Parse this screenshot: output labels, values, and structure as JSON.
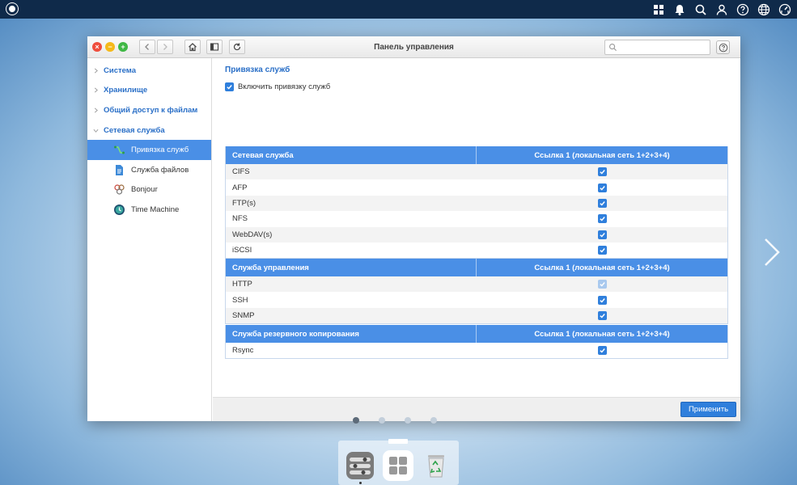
{
  "window": {
    "title": "Панель управления",
    "search_placeholder": ""
  },
  "sidebar": {
    "items": [
      {
        "label": "Система",
        "expanded": false
      },
      {
        "label": "Хранилище",
        "expanded": false
      },
      {
        "label": "Общий доступ к файлам",
        "expanded": false
      },
      {
        "label": "Сетевая служба",
        "expanded": true
      }
    ],
    "subitems": [
      {
        "label": "Привязка служб",
        "icon": "service-binding-icon",
        "active": true
      },
      {
        "label": "Служба файлов",
        "icon": "file-service-icon",
        "active": false
      },
      {
        "label": "Bonjour",
        "icon": "bonjour-icon",
        "active": false
      },
      {
        "label": "Time Machine",
        "icon": "time-machine-icon",
        "active": false
      }
    ]
  },
  "content": {
    "title": "Привязка служб",
    "enable_label": "Включить привязку служб",
    "enable_checked": true,
    "sections": [
      {
        "header": "Сетевая служба",
        "column": "Ссылка 1 (локальная сеть 1+2+3+4)",
        "rows": [
          {
            "name": "CIFS",
            "checked": true,
            "disabled": false
          },
          {
            "name": "AFP",
            "checked": true,
            "disabled": false
          },
          {
            "name": "FTP(s)",
            "checked": true,
            "disabled": false
          },
          {
            "name": "NFS",
            "checked": true,
            "disabled": false
          },
          {
            "name": "WebDAV(s)",
            "checked": true,
            "disabled": false
          },
          {
            "name": "iSCSI",
            "checked": true,
            "disabled": false
          }
        ]
      },
      {
        "header": "Служба управления",
        "column": "Ссылка 1 (локальная сеть 1+2+3+4)",
        "rows": [
          {
            "name": "HTTP",
            "checked": true,
            "disabled": true
          },
          {
            "name": "SSH",
            "checked": true,
            "disabled": false
          },
          {
            "name": "SNMP",
            "checked": true,
            "disabled": false
          }
        ]
      },
      {
        "header": "Служба резервного копирования",
        "column": "Ссылка 1 (локальная сеть 1+2+3+4)",
        "rows": [
          {
            "name": "Rsync",
            "checked": true,
            "disabled": false
          }
        ]
      }
    ],
    "apply_label": "Применить"
  },
  "colors": {
    "accent": "#4a8fe6",
    "checkbox": "#2f7fdc",
    "topbar": "#0f2a4a"
  }
}
